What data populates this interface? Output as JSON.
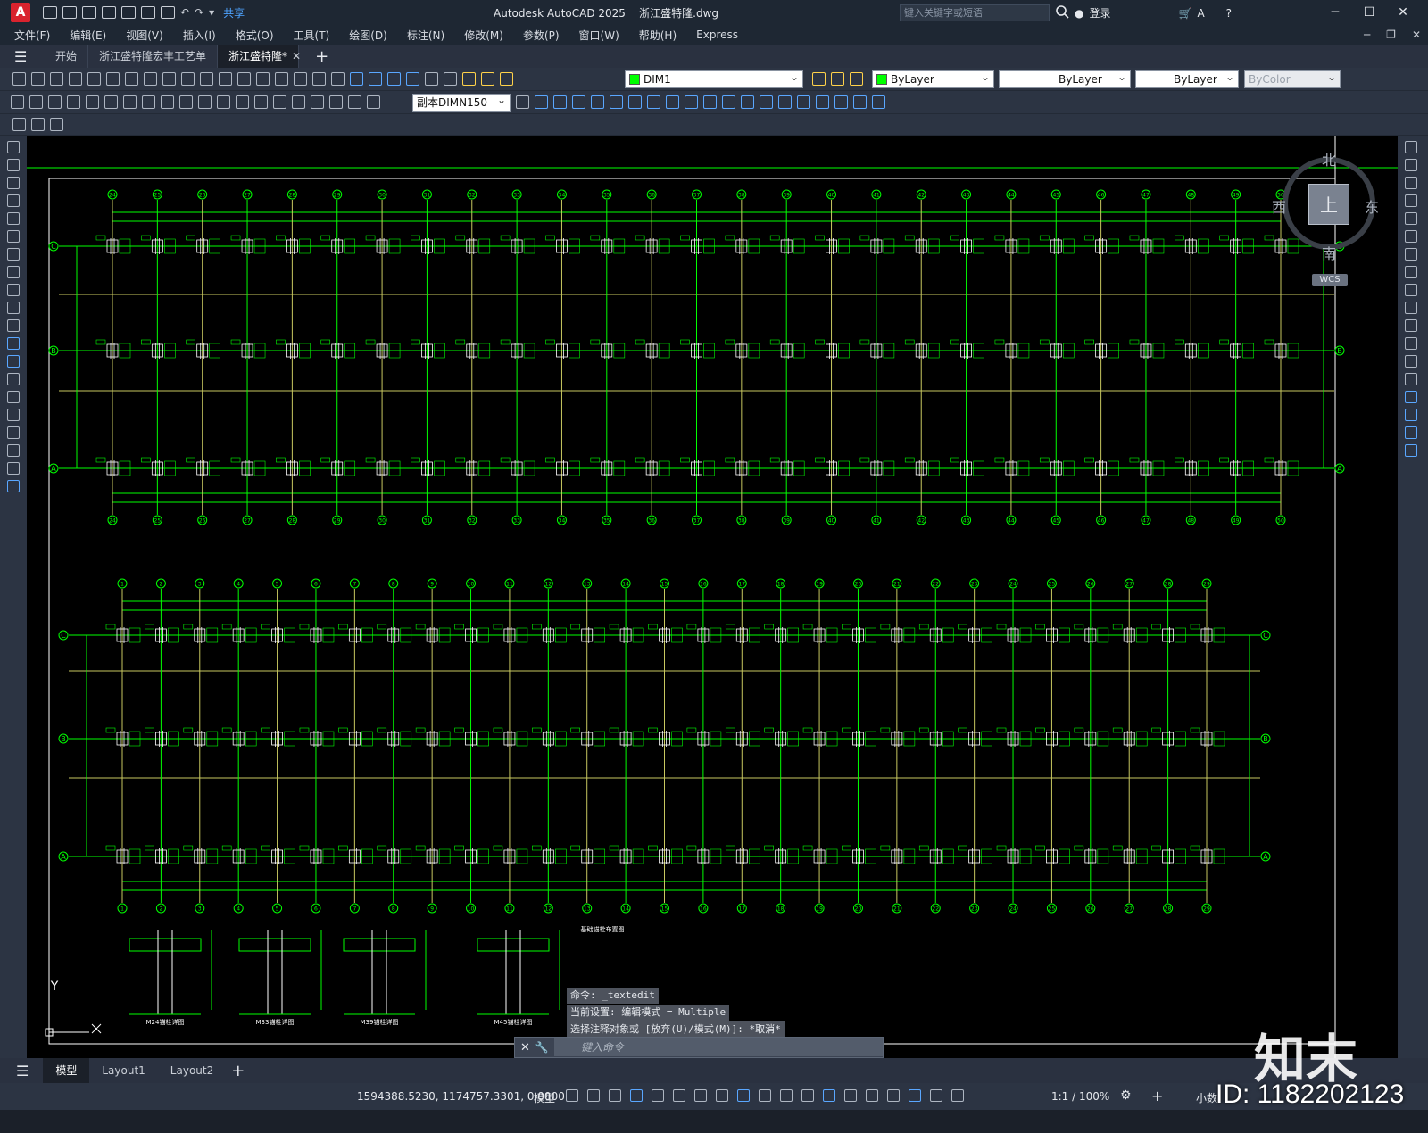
{
  "app": {
    "logo": "A",
    "title": "Autodesk AutoCAD 2025    浙江盛特隆.dwg",
    "share": "共享",
    "search_placeholder": "键入关键字或短语",
    "login": "登录"
  },
  "menu": [
    "文件(F)",
    "编辑(E)",
    "视图(V)",
    "插入(I)",
    "格式(O)",
    "工具(T)",
    "绘图(D)",
    "标注(N)",
    "修改(M)",
    "参数(P)",
    "窗口(W)",
    "帮助(H)",
    "Express"
  ],
  "file_tabs": [
    {
      "label": "开始",
      "active": false
    },
    {
      "label": "浙江盛特隆宏丰工艺单",
      "active": false
    },
    {
      "label": "浙江盛特隆*",
      "active": true
    }
  ],
  "toolbar": {
    "layer": "DIM1",
    "color": "ByLayer",
    "linetype": "ByLayer",
    "lineweight": "ByLayer",
    "plotstyle": "ByColor",
    "dimstyle": "副本DIMN150"
  },
  "viewcube": {
    "north": "北",
    "south": "南",
    "east": "东",
    "west": "西",
    "top": "上",
    "wcs": "WCS"
  },
  "ucs": {
    "y_label": "Y"
  },
  "command": {
    "history": [
      "命令: _textedit",
      "当前设置: 编辑模式 = Multiple",
      "选择注释对象或 [放弃(U)/模式(M)]: *取消*"
    ],
    "placeholder": "键入命令"
  },
  "layout_tabs": [
    {
      "label": "模型",
      "active": true
    },
    {
      "label": "Layout1",
      "active": false
    },
    {
      "label": "Layout2",
      "active": false
    }
  ],
  "status": {
    "coords": "1594388.5230, 1174757.3301, 0.0000",
    "space": "模型",
    "scale": "1:1 / 100%",
    "units": "小数"
  },
  "watermark": {
    "brand": "知末",
    "id": "ID: 1182202123"
  },
  "colors": {
    "grid_green": "#00ff00",
    "axis_yellow": "#c8c860",
    "canvas": "#000000",
    "accent_blue": "#4ea3ff"
  },
  "drawing": {
    "plan1_top_axes": [
      "24",
      "25",
      "26",
      "27",
      "28",
      "29",
      "30",
      "31",
      "32",
      "33",
      "34",
      "35",
      "36",
      "37",
      "38",
      "39",
      "40",
      "41",
      "42",
      "43",
      "44",
      "45",
      "46",
      "47",
      "48",
      "49",
      "50"
    ],
    "plan2_axes": [
      "1",
      "2",
      "3",
      "4",
      "5",
      "6",
      "7",
      "8",
      "9",
      "10",
      "11",
      "12",
      "13",
      "14",
      "15",
      "16",
      "17",
      "18",
      "19",
      "20",
      "21",
      "22",
      "23",
      "24",
      "25",
      "26",
      "27",
      "28",
      "29"
    ],
    "row_labels": [
      "C",
      "B",
      "A"
    ],
    "detail_labels": [
      "M24锚栓详图",
      "M33锚栓详图",
      "M39锚栓详图",
      "M45锚栓详图"
    ],
    "note_title": "基础锚栓布置图"
  }
}
